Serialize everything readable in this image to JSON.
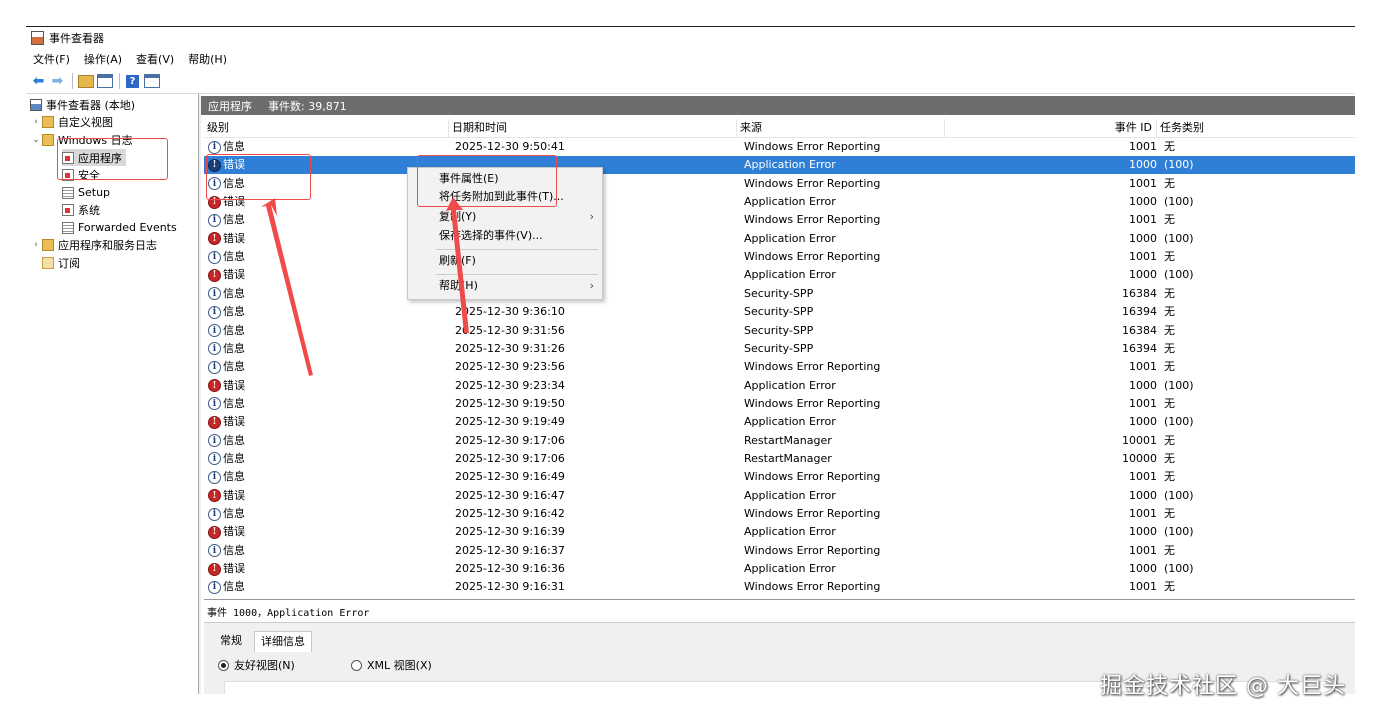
{
  "window": {
    "title": "事件查看器"
  },
  "menu": [
    "文件(F)",
    "操作(A)",
    "查看(V)",
    "帮助(H)"
  ],
  "toolbar": {
    "icons": [
      "back-arrow-icon",
      "forward-arrow-icon",
      "folder-up-icon",
      "show-hide-console-tree-icon",
      "help-icon",
      "show-hide-action-pane-icon"
    ]
  },
  "tree": {
    "root": "事件查看器 (本地)",
    "custom_views": "自定义视图",
    "windows_logs": "Windows 日志",
    "application": "应用程序",
    "security": "安全",
    "setup": "Setup",
    "system": "系统",
    "forwarded": "Forwarded Events",
    "app_service_logs": "应用程序和服务日志",
    "subscriptions": "订阅"
  },
  "panel": {
    "title": "应用程序",
    "count": "事件数: 39,871"
  },
  "grid": {
    "headers": {
      "level": "级别",
      "date": "日期和时间",
      "source": "来源",
      "event_id": "事件 ID",
      "task": "任务类别"
    },
    "rows": [
      {
        "kind": "info",
        "level": "信息",
        "date": "2025-12-30 9:50:41",
        "source": "Windows Error Reporting",
        "id": "1001",
        "task": "无"
      },
      {
        "kind": "err",
        "level": "错误",
        "date": "",
        "source": "Application Error",
        "id": "1000",
        "task": "(100)",
        "selected": true
      },
      {
        "kind": "info",
        "level": "信息",
        "date": "",
        "source": "Windows Error Reporting",
        "id": "1001",
        "task": "无"
      },
      {
        "kind": "err",
        "level": "错误",
        "date": "",
        "source": "Application Error",
        "id": "1000",
        "task": "(100)"
      },
      {
        "kind": "info",
        "level": "信息",
        "date": "",
        "source": "Windows Error Reporting",
        "id": "1001",
        "task": "无"
      },
      {
        "kind": "err",
        "level": "错误",
        "date": "",
        "source": "Application Error",
        "id": "1000",
        "task": "(100)"
      },
      {
        "kind": "info",
        "level": "信息",
        "date": "",
        "source": "Windows Error Reporting",
        "id": "1001",
        "task": "无"
      },
      {
        "kind": "err",
        "level": "错误",
        "date": "",
        "source": "Application Error",
        "id": "1000",
        "task": "(100)"
      },
      {
        "kind": "info",
        "level": "信息",
        "date": "",
        "source": "Security-SPP",
        "id": "16384",
        "task": "无"
      },
      {
        "kind": "info",
        "level": "信息",
        "date": "2025-12-30 9:36:10",
        "source": "Security-SPP",
        "id": "16394",
        "task": "无"
      },
      {
        "kind": "info",
        "level": "信息",
        "date": "2025-12-30 9:31:56",
        "source": "Security-SPP",
        "id": "16384",
        "task": "无"
      },
      {
        "kind": "info",
        "level": "信息",
        "date": "2025-12-30 9:31:26",
        "source": "Security-SPP",
        "id": "16394",
        "task": "无"
      },
      {
        "kind": "info",
        "level": "信息",
        "date": "2025-12-30 9:23:56",
        "source": "Windows Error Reporting",
        "id": "1001",
        "task": "无"
      },
      {
        "kind": "err",
        "level": "错误",
        "date": "2025-12-30 9:23:34",
        "source": "Application Error",
        "id": "1000",
        "task": "(100)"
      },
      {
        "kind": "info",
        "level": "信息",
        "date": "2025-12-30 9:19:50",
        "source": "Windows Error Reporting",
        "id": "1001",
        "task": "无"
      },
      {
        "kind": "err",
        "level": "错误",
        "date": "2025-12-30 9:19:49",
        "source": "Application Error",
        "id": "1000",
        "task": "(100)"
      },
      {
        "kind": "info",
        "level": "信息",
        "date": "2025-12-30 9:17:06",
        "source": "RestartManager",
        "id": "10001",
        "task": "无"
      },
      {
        "kind": "info",
        "level": "信息",
        "date": "2025-12-30 9:17:06",
        "source": "RestartManager",
        "id": "10000",
        "task": "无"
      },
      {
        "kind": "info",
        "level": "信息",
        "date": "2025-12-30 9:16:49",
        "source": "Windows Error Reporting",
        "id": "1001",
        "task": "无"
      },
      {
        "kind": "err",
        "level": "错误",
        "date": "2025-12-30 9:16:47",
        "source": "Application Error",
        "id": "1000",
        "task": "(100)"
      },
      {
        "kind": "info",
        "level": "信息",
        "date": "2025-12-30 9:16:42",
        "source": "Windows Error Reporting",
        "id": "1001",
        "task": "无"
      },
      {
        "kind": "err",
        "level": "错误",
        "date": "2025-12-30 9:16:39",
        "source": "Application Error",
        "id": "1000",
        "task": "(100)"
      },
      {
        "kind": "info",
        "level": "信息",
        "date": "2025-12-30 9:16:37",
        "source": "Windows Error Reporting",
        "id": "1001",
        "task": "无"
      },
      {
        "kind": "err",
        "level": "错误",
        "date": "2025-12-30 9:16:36",
        "source": "Application Error",
        "id": "1000",
        "task": "(100)"
      },
      {
        "kind": "info",
        "level": "信息",
        "date": "2025-12-30 9:16:31",
        "source": "Windows Error Reporting",
        "id": "1001",
        "task": "无"
      }
    ]
  },
  "context_menu": {
    "items": [
      "事件属性(E)",
      "将任务附加到此事件(T)...",
      "复制(Y)",
      "保存选择的事件(V)...",
      "刷新(F)",
      "帮助(H)"
    ],
    "submenu_glyph": "›"
  },
  "detail": {
    "title": "事件 1000，Application Error",
    "tabs": [
      "常规",
      "详细信息"
    ],
    "active_tab": "详细信息",
    "radio_friendly": "友好视图(N)",
    "radio_xml": "XML 视图(X)",
    "selected_radio": "友好视图(N)"
  },
  "annotation": {
    "color": "#ef4b4b"
  },
  "watermark": "掘金技术社区 @ 大巨头"
}
